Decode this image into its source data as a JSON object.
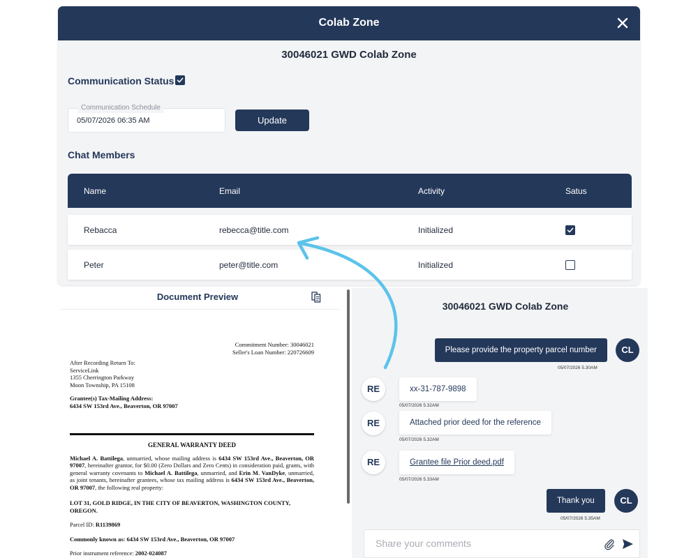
{
  "modal": {
    "title": "Colab Zone",
    "zone_title": "30046021 GWD Colab Zone",
    "communication_status_label": "Communication Status",
    "communication_status_checked": true,
    "schedule_label": "Communication Schedule",
    "schedule_value": "05/07/2026 06:35 AM",
    "update_label": "Update",
    "chat_members_label": "Chat Members",
    "table": {
      "headers": [
        "Name",
        "Email",
        "Activity",
        "Satus"
      ],
      "rows": [
        {
          "name": "Rebacca",
          "email": "rebecca@title.com",
          "activity": "Initialized",
          "status_checked": true
        },
        {
          "name": "Peter",
          "email": "peter@title.com",
          "activity": "Initialized",
          "status_checked": false
        }
      ]
    }
  },
  "document": {
    "title": "Document Preview",
    "commitment": "Commitment Number: 30046021",
    "loan": "Seller's Loan Number: 220726609",
    "return_to": [
      "After Recording Return To:",
      "ServiceLink",
      "1355 Cherrington Parkway",
      "Moon Township, PA 15108"
    ],
    "grantee_heading": "Grantee(s) Tax-Mailing Address:",
    "grantee_address": "6434 SW 153rd Ave., Beaverton, OR 97007",
    "deed_title": "GENERAL WARRANTY DEED",
    "para_p1_b1": "Michael A. Battilega",
    "para_p1_t1": ", unmarried, whose mailing address is ",
    "para_p1_b2": "6434 SW 153rd Ave., Beaverton, OR 97007",
    "para_p1_t2": ", hereinafter grantor, for $0.00 (Zero Dollars and Zero Cents) in consideration paid, grants, with general warranty covenants to ",
    "para_p1_b3": "Michael A. Battilega",
    "para_p1_t3": ", unmarried, and ",
    "para_p1_b4": "Erin M. VanDyke",
    "para_p1_t4": ", unmarried, as joint tenants, hereinafter grantees, whose tax mailing address is ",
    "para_p1_b5": "6434 SW 153rd Ave., Beaverton, OR 97007",
    "para_p1_t5": ", the following real property:",
    "lot": "LOT 31, GOLD RIDGE, IN THE CITY OF BEAVERTON, WASHINGTON COUNTY, OREGON.",
    "parcel_label": "Parcel ID: ",
    "parcel_value": "R1139869",
    "known_label": "Commonly known as: ",
    "known_value": "6434 SW 153rd Ave., Beaverton, OR 97007",
    "prior_label": "Prior instrument reference: ",
    "prior_value": "2002-024087"
  },
  "chat": {
    "title": "30046021 GWD Colab Zone",
    "messages": [
      {
        "avatar": "CL",
        "text": "Please provide the property parcel number",
        "time": "05/07/2026 5.30AM"
      },
      {
        "avatar": "RE",
        "text": "xx-31-787-9898",
        "time": "05/07/2026 5.32AM"
      },
      {
        "avatar": "RE",
        "text": "Attached prior deed for the reference",
        "time": "05/07/2026 5.32AM"
      },
      {
        "avatar": "RE",
        "text": "Grantee file Prior deed.pdf",
        "time": "05/07/2026 5.33AM"
      },
      {
        "avatar": "CL",
        "text": "Thank you",
        "time": "05/07/2026 5.35AM"
      }
    ],
    "composer_placeholder": "Share your comments"
  },
  "colors": {
    "navy": "#24385a",
    "panel": "#f3f4f6",
    "arrow": "#5bc3ea"
  }
}
